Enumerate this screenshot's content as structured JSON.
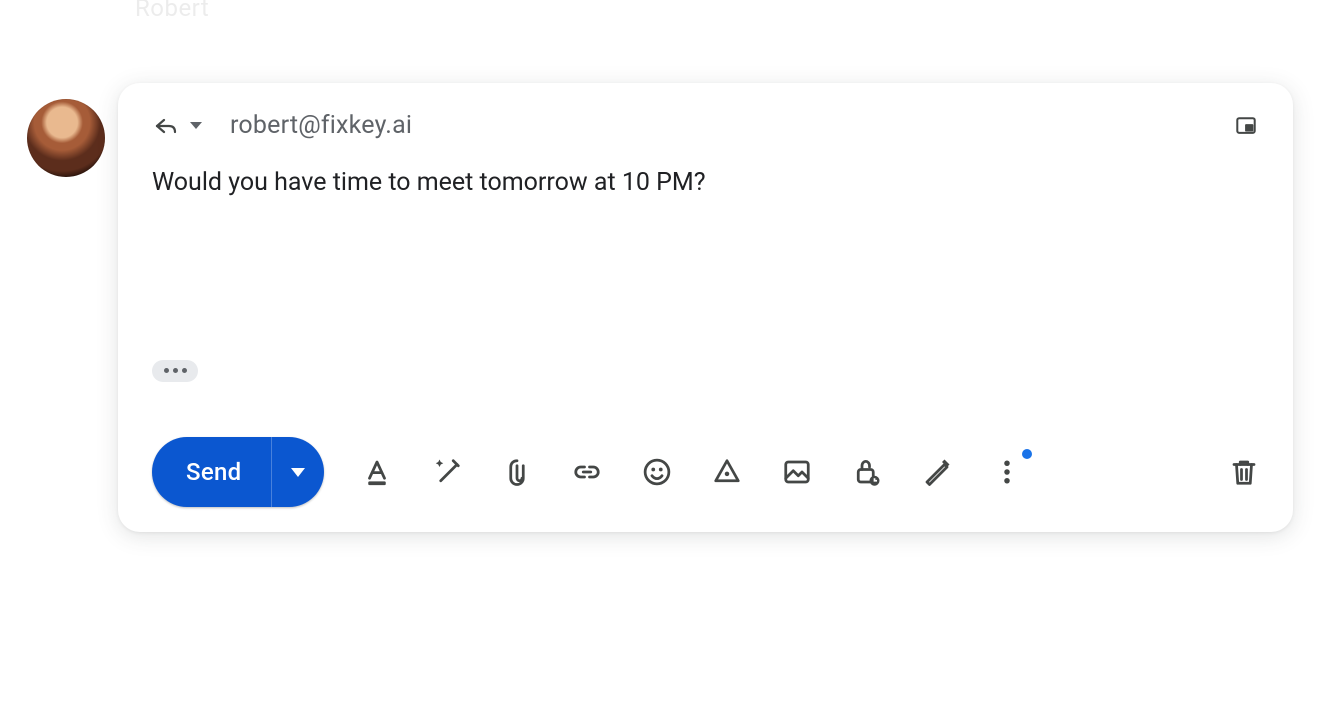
{
  "thread": {
    "sender_hint": "Robert"
  },
  "compose": {
    "recipient": "robert@fixkey.ai",
    "body": "Would you have time to meet tomorrow at 10 PM?",
    "send_label": "Send"
  },
  "toolbar": {
    "icons": {
      "formatting": "Formatting options",
      "help_me_write": "Help me write",
      "attach": "Attach files",
      "link": "Insert link",
      "emoji": "Insert emoji",
      "drive": "Insert files from Drive",
      "photo": "Insert photo",
      "confidential": "Toggle confidential mode",
      "signature": "Insert signature",
      "more": "More options",
      "discard": "Discard draft",
      "popout": "Open in new window",
      "reply": "Reply",
      "reply_more": "Type of response"
    }
  }
}
